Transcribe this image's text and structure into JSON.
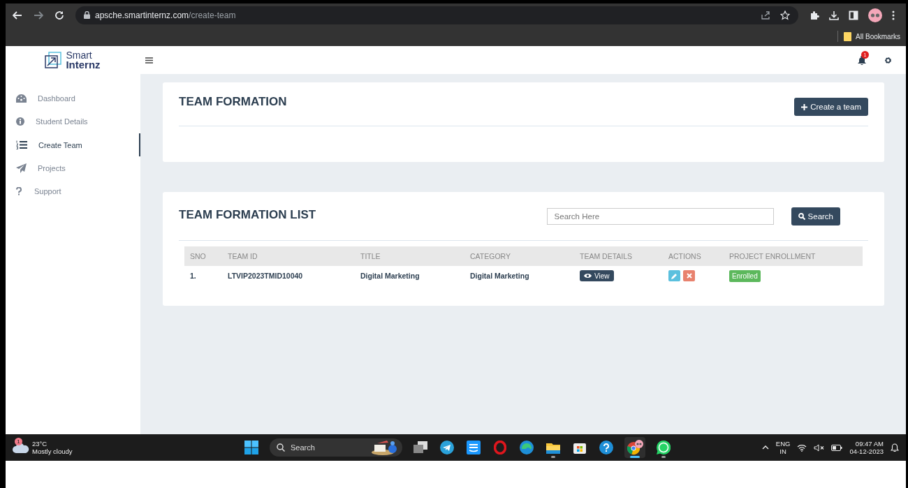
{
  "browser": {
    "url_host": "apsche.smartinternz.com",
    "url_path": "/create-team",
    "bookmarks_label": "All Bookmarks"
  },
  "brand": {
    "line1": "Smart",
    "line2": "Internz"
  },
  "header": {
    "notification_count": "1"
  },
  "sidebar": {
    "items": [
      {
        "label": "Dashboard",
        "kind": "gauge",
        "selected": false
      },
      {
        "label": "Student Details",
        "kind": "info",
        "selected": false
      },
      {
        "label": "Create Team",
        "kind": "list",
        "selected": true
      },
      {
        "label": "Projects",
        "kind": "plane",
        "selected": false
      },
      {
        "label": "Support",
        "kind": "question",
        "selected": false
      }
    ]
  },
  "team_formation": {
    "title": "TEAM FORMATION",
    "button": "Create a team"
  },
  "team_list": {
    "title": "TEAM FORMATION LIST",
    "search": {
      "placeholder": "Search Here"
    },
    "search_button": "Search",
    "columns": [
      "SNO",
      "TEAM ID",
      "TITLE",
      "CATEGORY",
      "TEAM DETAILS",
      "ACTIONS",
      "PROJECT ENROLLMENT"
    ],
    "rows": [
      {
        "sno": "1.",
        "team_id": "LTVIP2023TMID10040",
        "title": "Digital Marketing",
        "category": "Digital Marketing",
        "details_button": "View",
        "status": "Enrolled"
      }
    ]
  },
  "taskbar": {
    "weather": {
      "temperature": "23°C",
      "condition": "Mostly cloudy",
      "badge": "1"
    },
    "search_placeholder": "Search",
    "apps": [
      {
        "kind": "windows",
        "running": false,
        "selected": false
      },
      {
        "kind": "taskview",
        "running": false,
        "selected": false
      },
      {
        "kind": "telegram",
        "running": false,
        "selected": false
      },
      {
        "kind": "video",
        "running": false,
        "selected": false
      },
      {
        "kind": "opera",
        "running": false,
        "selected": false
      },
      {
        "kind": "edge",
        "running": false,
        "selected": false
      },
      {
        "kind": "files",
        "running": true,
        "selected": false
      },
      {
        "kind": "store",
        "running": false,
        "selected": false
      },
      {
        "kind": "help",
        "running": false,
        "selected": false
      },
      {
        "kind": "chrome",
        "running": true,
        "selected": true
      },
      {
        "kind": "whatsapp",
        "running": true,
        "selected": false
      }
    ],
    "language": "ENG",
    "region": "IN",
    "time": "09:47 AM",
    "date": "04-12-2023"
  }
}
